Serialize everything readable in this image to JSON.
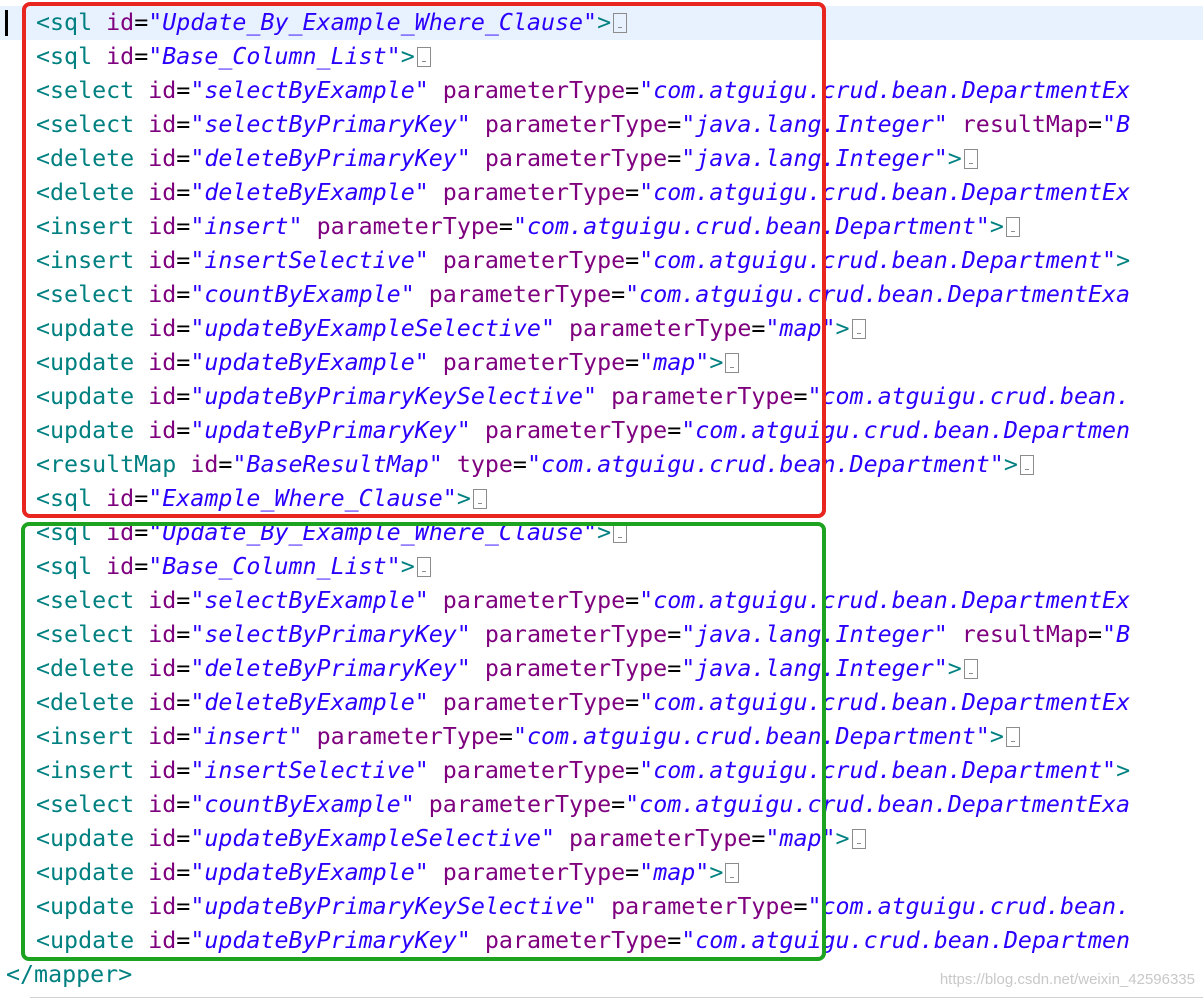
{
  "lines": [
    [
      [
        "tag",
        "<sql"
      ],
      [
        "sp",
        " "
      ],
      [
        "attr",
        "id"
      ],
      [
        "eq",
        "="
      ],
      [
        "val",
        "\"Update_By_Example_Where_Clause\""
      ],
      [
        "tag",
        ">"
      ],
      [
        "fold",
        ""
      ]
    ],
    [
      [
        "tag",
        "<sql"
      ],
      [
        "sp",
        " "
      ],
      [
        "attr",
        "id"
      ],
      [
        "eq",
        "="
      ],
      [
        "val",
        "\"Base_Column_List\""
      ],
      [
        "tag",
        ">"
      ],
      [
        "fold",
        ""
      ]
    ],
    [
      [
        "tag",
        "<select"
      ],
      [
        "sp",
        " "
      ],
      [
        "attr",
        "id"
      ],
      [
        "eq",
        "="
      ],
      [
        "val",
        "\"selectByExample\""
      ],
      [
        "sp",
        " "
      ],
      [
        "attr",
        "parameterType"
      ],
      [
        "eq",
        "="
      ],
      [
        "val",
        "\"com.atguigu.crud.bean.DepartmentEx"
      ]
    ],
    [
      [
        "tag",
        "<select"
      ],
      [
        "sp",
        " "
      ],
      [
        "attr",
        "id"
      ],
      [
        "eq",
        "="
      ],
      [
        "val",
        "\"selectByPrimaryKey\""
      ],
      [
        "sp",
        " "
      ],
      [
        "attr",
        "parameterType"
      ],
      [
        "eq",
        "="
      ],
      [
        "val",
        "\"java.lang.Integer\""
      ],
      [
        "sp",
        " "
      ],
      [
        "attr",
        "resultMap"
      ],
      [
        "eq",
        "="
      ],
      [
        "val",
        "\"B"
      ]
    ],
    [
      [
        "tag",
        "<delete"
      ],
      [
        "sp",
        " "
      ],
      [
        "attr",
        "id"
      ],
      [
        "eq",
        "="
      ],
      [
        "val",
        "\"deleteByPrimaryKey\""
      ],
      [
        "sp",
        " "
      ],
      [
        "attr",
        "parameterType"
      ],
      [
        "eq",
        "="
      ],
      [
        "val",
        "\"java.lang.Integer\""
      ],
      [
        "tag",
        ">"
      ],
      [
        "fold",
        ""
      ]
    ],
    [
      [
        "tag",
        "<delete"
      ],
      [
        "sp",
        " "
      ],
      [
        "attr",
        "id"
      ],
      [
        "eq",
        "="
      ],
      [
        "val",
        "\"deleteByExample\""
      ],
      [
        "sp",
        " "
      ],
      [
        "attr",
        "parameterType"
      ],
      [
        "eq",
        "="
      ],
      [
        "val",
        "\"com.atguigu.crud.bean.DepartmentEx"
      ]
    ],
    [
      [
        "tag",
        "<insert"
      ],
      [
        "sp",
        " "
      ],
      [
        "attr",
        "id"
      ],
      [
        "eq",
        "="
      ],
      [
        "val",
        "\"insert\""
      ],
      [
        "sp",
        " "
      ],
      [
        "attr",
        "parameterType"
      ],
      [
        "eq",
        "="
      ],
      [
        "val",
        "\"com.atguigu.crud.bean.Department\""
      ],
      [
        "tag",
        ">"
      ],
      [
        "fold",
        ""
      ]
    ],
    [
      [
        "tag",
        "<insert"
      ],
      [
        "sp",
        " "
      ],
      [
        "attr",
        "id"
      ],
      [
        "eq",
        "="
      ],
      [
        "val",
        "\"insertSelective\""
      ],
      [
        "sp",
        " "
      ],
      [
        "attr",
        "parameterType"
      ],
      [
        "eq",
        "="
      ],
      [
        "val",
        "\"com.atguigu.crud.bean.Department\""
      ],
      [
        "tag",
        ">"
      ]
    ],
    [
      [
        "tag",
        "<select"
      ],
      [
        "sp",
        " "
      ],
      [
        "attr",
        "id"
      ],
      [
        "eq",
        "="
      ],
      [
        "val",
        "\"countByExample\""
      ],
      [
        "sp",
        " "
      ],
      [
        "attr",
        "parameterType"
      ],
      [
        "eq",
        "="
      ],
      [
        "val",
        "\"com.atguigu.crud.bean.DepartmentExa"
      ]
    ],
    [
      [
        "tag",
        "<update"
      ],
      [
        "sp",
        " "
      ],
      [
        "attr",
        "id"
      ],
      [
        "eq",
        "="
      ],
      [
        "val",
        "\"updateByExampleSelective\""
      ],
      [
        "sp",
        " "
      ],
      [
        "attr",
        "parameterType"
      ],
      [
        "eq",
        "="
      ],
      [
        "val",
        "\"map\""
      ],
      [
        "tag",
        ">"
      ],
      [
        "fold",
        ""
      ]
    ],
    [
      [
        "tag",
        "<update"
      ],
      [
        "sp",
        " "
      ],
      [
        "attr",
        "id"
      ],
      [
        "eq",
        "="
      ],
      [
        "val",
        "\"updateByExample\""
      ],
      [
        "sp",
        " "
      ],
      [
        "attr",
        "parameterType"
      ],
      [
        "eq",
        "="
      ],
      [
        "val",
        "\"map\""
      ],
      [
        "tag",
        ">"
      ],
      [
        "fold",
        ""
      ]
    ],
    [
      [
        "tag",
        "<update"
      ],
      [
        "sp",
        " "
      ],
      [
        "attr",
        "id"
      ],
      [
        "eq",
        "="
      ],
      [
        "val",
        "\"updateByPrimaryKeySelective\""
      ],
      [
        "sp",
        " "
      ],
      [
        "attr",
        "parameterType"
      ],
      [
        "eq",
        "="
      ],
      [
        "val",
        "\"com.atguigu.crud.bean."
      ]
    ],
    [
      [
        "tag",
        "<update"
      ],
      [
        "sp",
        " "
      ],
      [
        "attr",
        "id"
      ],
      [
        "eq",
        "="
      ],
      [
        "val",
        "\"updateByPrimaryKey\""
      ],
      [
        "sp",
        " "
      ],
      [
        "attr",
        "parameterType"
      ],
      [
        "eq",
        "="
      ],
      [
        "val",
        "\"com.atguigu.crud.bean.Departmen"
      ]
    ],
    [
      [
        "tag",
        "<resultMap"
      ],
      [
        "sp",
        " "
      ],
      [
        "attr",
        "id"
      ],
      [
        "eq",
        "="
      ],
      [
        "val",
        "\"BaseResultMap\""
      ],
      [
        "sp",
        " "
      ],
      [
        "attr",
        "type"
      ],
      [
        "eq",
        "="
      ],
      [
        "val",
        "\"com.atguigu.crud.bean.Department\""
      ],
      [
        "tag",
        ">"
      ],
      [
        "fold",
        ""
      ]
    ],
    [
      [
        "tag",
        "<sql"
      ],
      [
        "sp",
        " "
      ],
      [
        "attr",
        "id"
      ],
      [
        "eq",
        "="
      ],
      [
        "val",
        "\"Example_Where_Clause\""
      ],
      [
        "tag",
        ">"
      ],
      [
        "fold",
        ""
      ]
    ],
    [
      [
        "tag",
        "<sql"
      ],
      [
        "sp",
        " "
      ],
      [
        "attr",
        "id"
      ],
      [
        "eq",
        "="
      ],
      [
        "val",
        "\"Update_By_Example_Where_Clause\""
      ],
      [
        "tag",
        ">"
      ],
      [
        "fold",
        ""
      ]
    ],
    [
      [
        "tag",
        "<sql"
      ],
      [
        "sp",
        " "
      ],
      [
        "attr",
        "id"
      ],
      [
        "eq",
        "="
      ],
      [
        "val",
        "\"Base_Column_List\""
      ],
      [
        "tag",
        ">"
      ],
      [
        "fold",
        ""
      ]
    ],
    [
      [
        "tag",
        "<select"
      ],
      [
        "sp",
        " "
      ],
      [
        "attr",
        "id"
      ],
      [
        "eq",
        "="
      ],
      [
        "val",
        "\"selectByExample\""
      ],
      [
        "sp",
        " "
      ],
      [
        "attr",
        "parameterType"
      ],
      [
        "eq",
        "="
      ],
      [
        "val",
        "\"com.atguigu.crud.bean.DepartmentEx"
      ]
    ],
    [
      [
        "tag",
        "<select"
      ],
      [
        "sp",
        " "
      ],
      [
        "attr",
        "id"
      ],
      [
        "eq",
        "="
      ],
      [
        "val",
        "\"selectByPrimaryKey\""
      ],
      [
        "sp",
        " "
      ],
      [
        "attr",
        "parameterType"
      ],
      [
        "eq",
        "="
      ],
      [
        "val",
        "\"java.lang.Integer\""
      ],
      [
        "sp",
        " "
      ],
      [
        "attr",
        "resultMap"
      ],
      [
        "eq",
        "="
      ],
      [
        "val",
        "\"B"
      ]
    ],
    [
      [
        "tag",
        "<delete"
      ],
      [
        "sp",
        " "
      ],
      [
        "attr",
        "id"
      ],
      [
        "eq",
        "="
      ],
      [
        "val",
        "\"deleteByPrimaryKey\""
      ],
      [
        "sp",
        " "
      ],
      [
        "attr",
        "parameterType"
      ],
      [
        "eq",
        "="
      ],
      [
        "val",
        "\"java.lang.Integer\""
      ],
      [
        "tag",
        ">"
      ],
      [
        "fold",
        ""
      ]
    ],
    [
      [
        "tag",
        "<delete"
      ],
      [
        "sp",
        " "
      ],
      [
        "attr",
        "id"
      ],
      [
        "eq",
        "="
      ],
      [
        "val",
        "\"deleteByExample\""
      ],
      [
        "sp",
        " "
      ],
      [
        "attr",
        "parameterType"
      ],
      [
        "eq",
        "="
      ],
      [
        "val",
        "\"com.atguigu.crud.bean.DepartmentEx"
      ]
    ],
    [
      [
        "tag",
        "<insert"
      ],
      [
        "sp",
        " "
      ],
      [
        "attr",
        "id"
      ],
      [
        "eq",
        "="
      ],
      [
        "val",
        "\"insert\""
      ],
      [
        "sp",
        " "
      ],
      [
        "attr",
        "parameterType"
      ],
      [
        "eq",
        "="
      ],
      [
        "val",
        "\"com.atguigu.crud.bean.Department\""
      ],
      [
        "tag",
        ">"
      ],
      [
        "fold",
        ""
      ]
    ],
    [
      [
        "tag",
        "<insert"
      ],
      [
        "sp",
        " "
      ],
      [
        "attr",
        "id"
      ],
      [
        "eq",
        "="
      ],
      [
        "val",
        "\"insertSelective\""
      ],
      [
        "sp",
        " "
      ],
      [
        "attr",
        "parameterType"
      ],
      [
        "eq",
        "="
      ],
      [
        "val",
        "\"com.atguigu.crud.bean.Department\""
      ],
      [
        "tag",
        ">"
      ]
    ],
    [
      [
        "tag",
        "<select"
      ],
      [
        "sp",
        " "
      ],
      [
        "attr",
        "id"
      ],
      [
        "eq",
        "="
      ],
      [
        "val",
        "\"countByExample\""
      ],
      [
        "sp",
        " "
      ],
      [
        "attr",
        "parameterType"
      ],
      [
        "eq",
        "="
      ],
      [
        "val",
        "\"com.atguigu.crud.bean.DepartmentExa"
      ]
    ],
    [
      [
        "tag",
        "<update"
      ],
      [
        "sp",
        " "
      ],
      [
        "attr",
        "id"
      ],
      [
        "eq",
        "="
      ],
      [
        "val",
        "\"updateByExampleSelective\""
      ],
      [
        "sp",
        " "
      ],
      [
        "attr",
        "parameterType"
      ],
      [
        "eq",
        "="
      ],
      [
        "val",
        "\"map\""
      ],
      [
        "tag",
        ">"
      ],
      [
        "fold",
        ""
      ]
    ],
    [
      [
        "tag",
        "<update"
      ],
      [
        "sp",
        " "
      ],
      [
        "attr",
        "id"
      ],
      [
        "eq",
        "="
      ],
      [
        "val",
        "\"updateByExample\""
      ],
      [
        "sp",
        " "
      ],
      [
        "attr",
        "parameterType"
      ],
      [
        "eq",
        "="
      ],
      [
        "val",
        "\"map\""
      ],
      [
        "tag",
        ">"
      ],
      [
        "fold",
        ""
      ]
    ],
    [
      [
        "tag",
        "<update"
      ],
      [
        "sp",
        " "
      ],
      [
        "attr",
        "id"
      ],
      [
        "eq",
        "="
      ],
      [
        "val",
        "\"updateByPrimaryKeySelective\""
      ],
      [
        "sp",
        " "
      ],
      [
        "attr",
        "parameterType"
      ],
      [
        "eq",
        "="
      ],
      [
        "val",
        "\"com.atguigu.crud.bean."
      ]
    ],
    [
      [
        "tag",
        "<update"
      ],
      [
        "sp",
        " "
      ],
      [
        "attr",
        "id"
      ],
      [
        "eq",
        "="
      ],
      [
        "val",
        "\"updateByPrimaryKey\""
      ],
      [
        "sp",
        " "
      ],
      [
        "attr",
        "parameterType"
      ],
      [
        "eq",
        "="
      ],
      [
        "val",
        "\"com.atguigu.crud.bean.Departmen"
      ]
    ],
    [
      [
        "tag",
        "</mapper>"
      ]
    ]
  ],
  "watermark": "https://blog.csdn.net/weixin_42596335",
  "colors": {
    "tag": "#008080",
    "attr": "#7f007f",
    "value": "#2a00ff",
    "red_box": "#e8251f",
    "green_box": "#1ea320",
    "current_line": "#e8f2fe"
  }
}
